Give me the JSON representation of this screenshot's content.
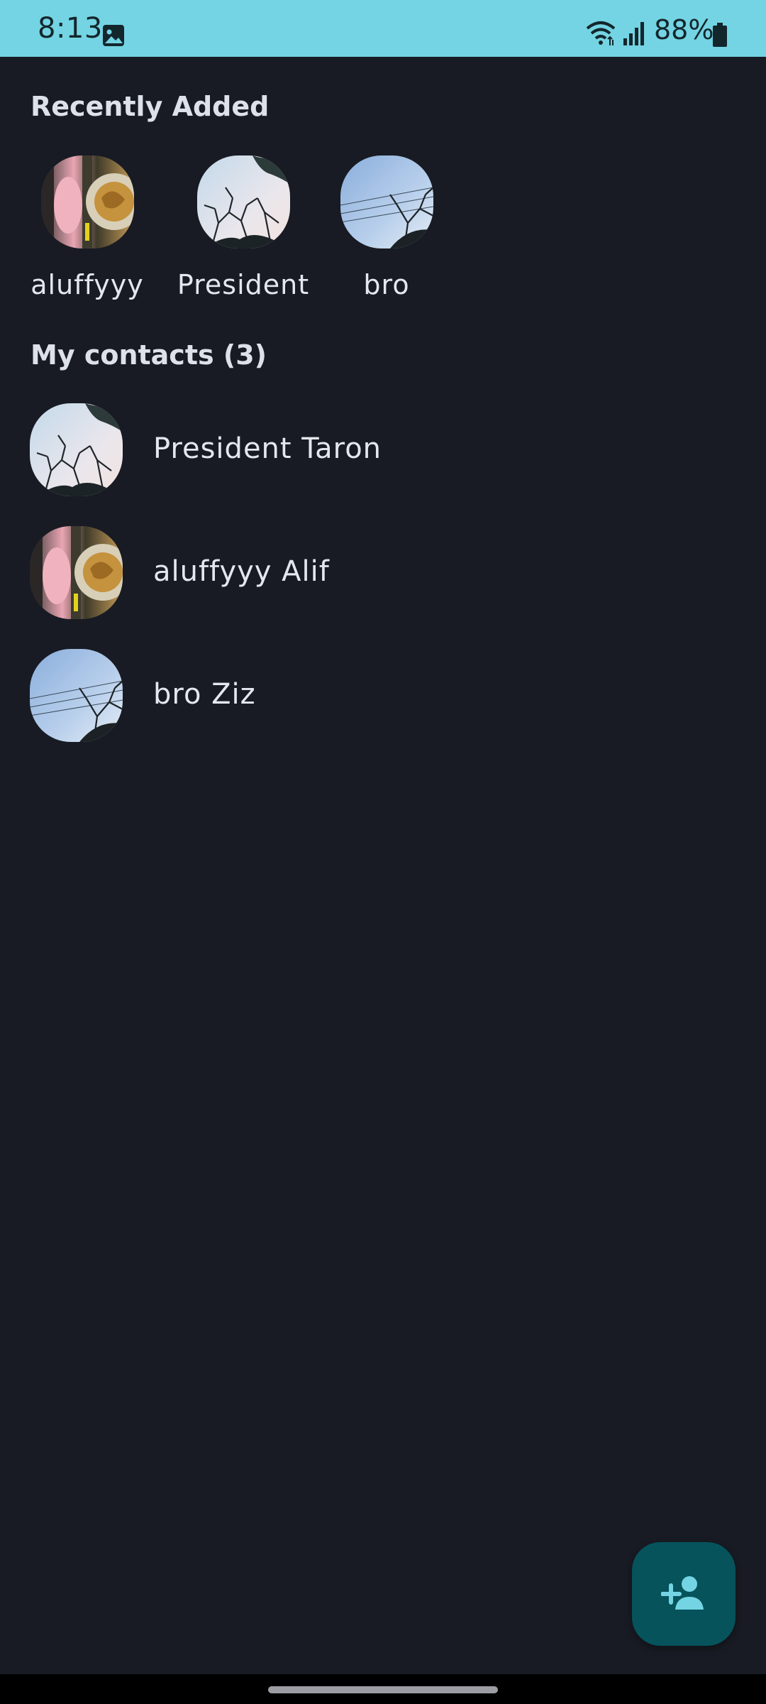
{
  "status_bar": {
    "time": "8:13",
    "battery": "88%",
    "icons": [
      "gallery-icon",
      "wifi-icon",
      "signal-icon",
      "battery-icon"
    ]
  },
  "recently_added": {
    "title": "Recently Added",
    "items": [
      {
        "label": "aluffyyy",
        "avatar": "food-photo"
      },
      {
        "label": "President",
        "avatar": "tree-sky-photo"
      },
      {
        "label": "bro",
        "avatar": "blue-sky-photo"
      }
    ]
  },
  "contacts": {
    "title": "My contacts (3)",
    "items": [
      {
        "name": "President Taron",
        "avatar": "tree-sky-photo"
      },
      {
        "name": "aluffyyy Alif",
        "avatar": "food-photo"
      },
      {
        "name": "bro Ziz",
        "avatar": "blue-sky-photo"
      }
    ]
  },
  "fab": {
    "icon": "add-person-icon"
  },
  "colors": {
    "status_bar": "#74d4e3",
    "background": "#181b23",
    "fab": "#06535c",
    "fab_icon": "#74d4e3",
    "text": "#e4e7ee"
  }
}
